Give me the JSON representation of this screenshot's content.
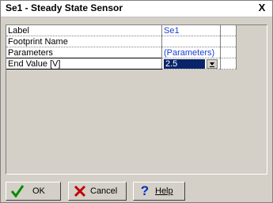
{
  "window": {
    "title": "Se1 - Steady State Sensor",
    "close_label": "X"
  },
  "properties": [
    {
      "label": "Label",
      "value": "Se1"
    },
    {
      "label": "Footprint Name",
      "value": ""
    },
    {
      "label": "Parameters",
      "value": "(Parameters)"
    },
    {
      "label": "End Value [V]",
      "value": "2.5"
    }
  ],
  "buttons": {
    "ok": "OK",
    "cancel": "Cancel",
    "help": "Help"
  },
  "colors": {
    "accent": "#0a246a",
    "value_text": "#1a3fd6",
    "ok_icon": "#0a8a0a",
    "cancel_icon": "#c00000",
    "help_icon": "#0030c0"
  }
}
